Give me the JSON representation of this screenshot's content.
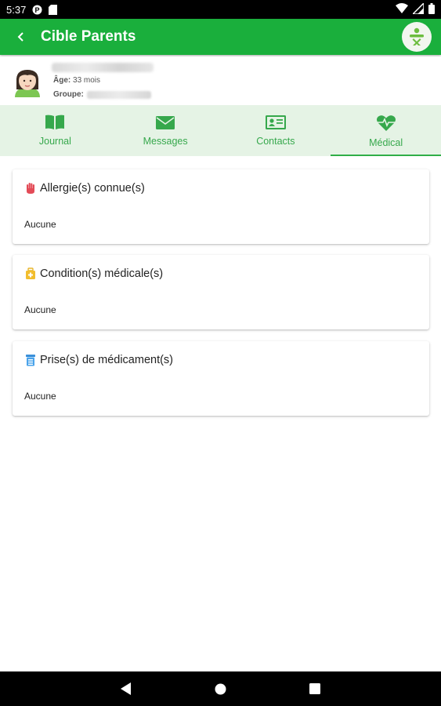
{
  "status_bar": {
    "time": "5:37"
  },
  "app_bar": {
    "title": "Cible Parents"
  },
  "child": {
    "age_label": "Âge:",
    "age_value": "33 mois",
    "group_label": "Groupe:"
  },
  "tabs": [
    {
      "label": "Journal",
      "icon": "book-icon",
      "active": false
    },
    {
      "label": "Messages",
      "icon": "envelope-icon",
      "active": false
    },
    {
      "label": "Contacts",
      "icon": "id-card-icon",
      "active": false
    },
    {
      "label": "Médical",
      "icon": "heartbeat-icon",
      "active": true
    }
  ],
  "sections": [
    {
      "title": "Allergie(s) connue(s)",
      "value": "Aucune",
      "icon": "hand-icon"
    },
    {
      "title": "Condition(s) médicale(s)",
      "value": "Aucune",
      "icon": "medical-bag-icon"
    },
    {
      "title": "Prise(s) de médicament(s)",
      "value": "Aucune",
      "icon": "pill-bottle-icon"
    }
  ],
  "colors": {
    "primary": "#1aaf3c",
    "tab_background": "#e5f3e5",
    "tab_text": "#36a84c"
  }
}
